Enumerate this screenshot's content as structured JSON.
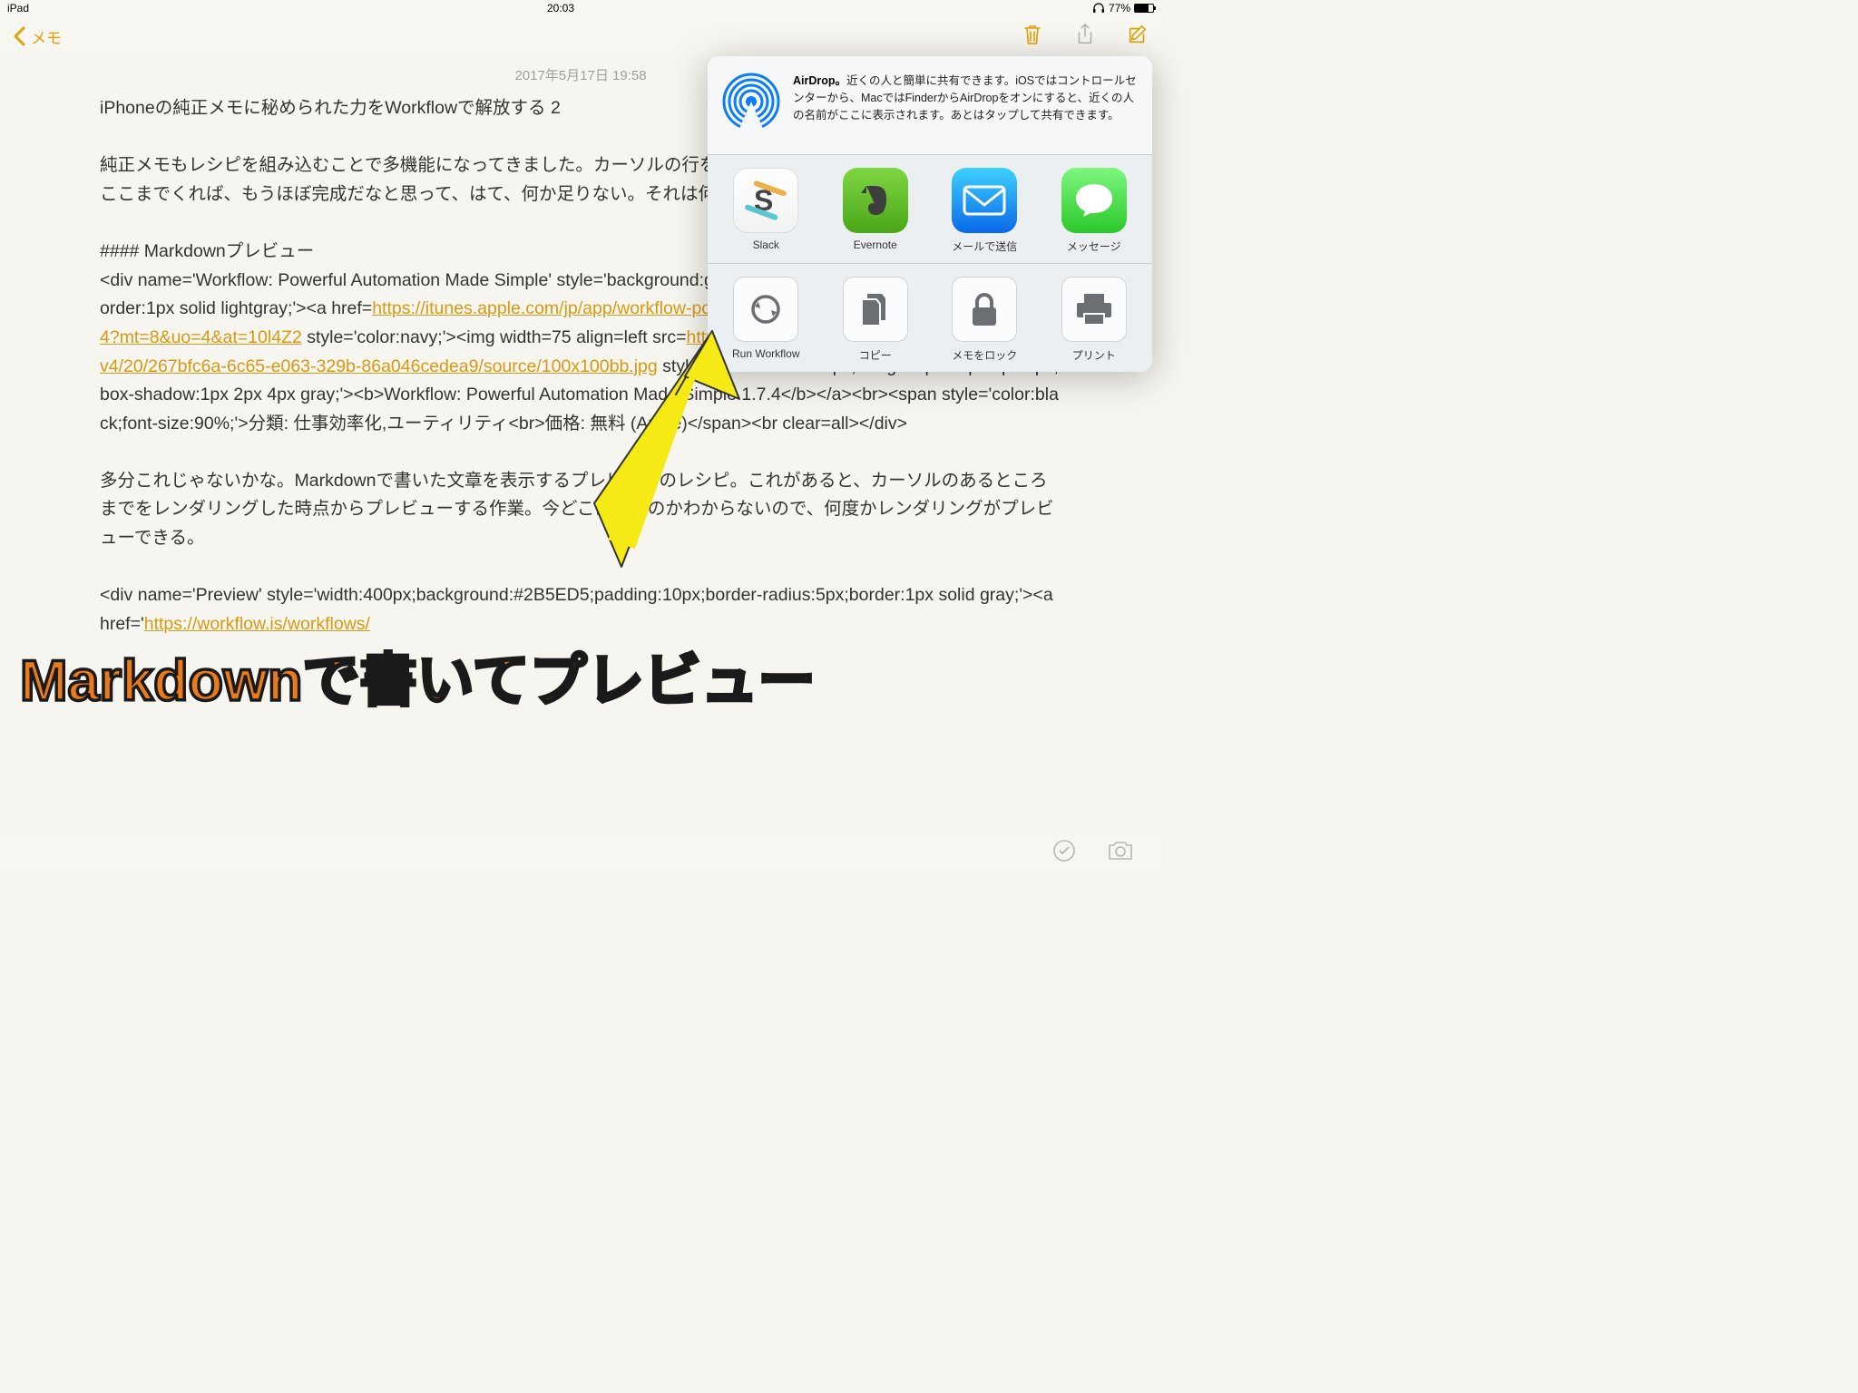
{
  "status": {
    "device": "iPad",
    "time": "20:03",
    "battery_pct": "77%"
  },
  "nav": {
    "back_label": "メモ"
  },
  "note": {
    "timestamp": "2017年5月17日 19:58",
    "title": "iPhoneの純正メモに秘められた力をWorkflowで解放する 2",
    "para1": "純正メモもレシピを組み込むことで多機能になってきました。カーソルの行を取り込んで、Evernoteに転送して・・・。ここまでくれば、もうほぼ完成だなと思って、はて、何か足りない。それは何だ？",
    "heading": "#### Markdownプレビュー",
    "code_pre": "<div name='Workflow: Powerful Automation Made Simple' style='background:ghostwhite;padding:10px;border-radius:5px;border:1px solid lightgray;'><a href=",
    "link1": "https://itunes.apple.com/jp/app/workflow-powerful-automation-made-simple/id915249334?mt=8&uo=4&at=10l4Z2",
    "code_mid": " style='color:navy;'><img width=75 align=left src=",
    "link2": "http://is4.mzstatic.com/image/thumb/Purple127/v4/20/267bfc6a-6c65-e063-329b-86a046cedea9/source/100x100bb.jpg",
    "code_post": " style='border-radius:5px;margin:1px 15px 1px 1px;box-shadow:1px 2px 4px gray;'><b>Workflow: Powerful Automation Made Simple 1.7.4</b></a><br><span style='color:black;font-size:90%;'>分類: 仕事効率化,ユーティリティ<br>価格: 無料 (Apple)</span><br clear=all></div>",
    "para2": "多分これじゃないかな。Markdownで書いた文章を表示するプレビューのレシピ。これがあると、カーソルのあるところまでをレンダリングした時点からプレビューする作業。今どこにいるのかわからないので、何度かレンダリングがプレビューできる。",
    "code2_pre": "<div name='Preview' style='width:400px;background:#2B5ED5;padding:10px;border-radius:5px;border:1px solid gray;'><a href='",
    "link3": "https://workflow.is/workflows/"
  },
  "share": {
    "airdrop_text": "近くの人と簡単に共有できます。iOSではコントロールセンターから、MacではFinderからAirDropをオンにすると、近くの人の名前がここに表示されます。あとはタップして共有できます。",
    "airdrop_label": "AirDrop。",
    "apps": [
      {
        "label": "Slack"
      },
      {
        "label": "Evernote"
      },
      {
        "label": "メールで送信"
      },
      {
        "label": "メッセージ"
      }
    ],
    "actions": [
      {
        "label": "Run Workflow"
      },
      {
        "label": "コピー"
      },
      {
        "label": "メモをロック"
      },
      {
        "label": "プリント"
      }
    ]
  },
  "annotation": "Markdownで書いてプレビュー"
}
